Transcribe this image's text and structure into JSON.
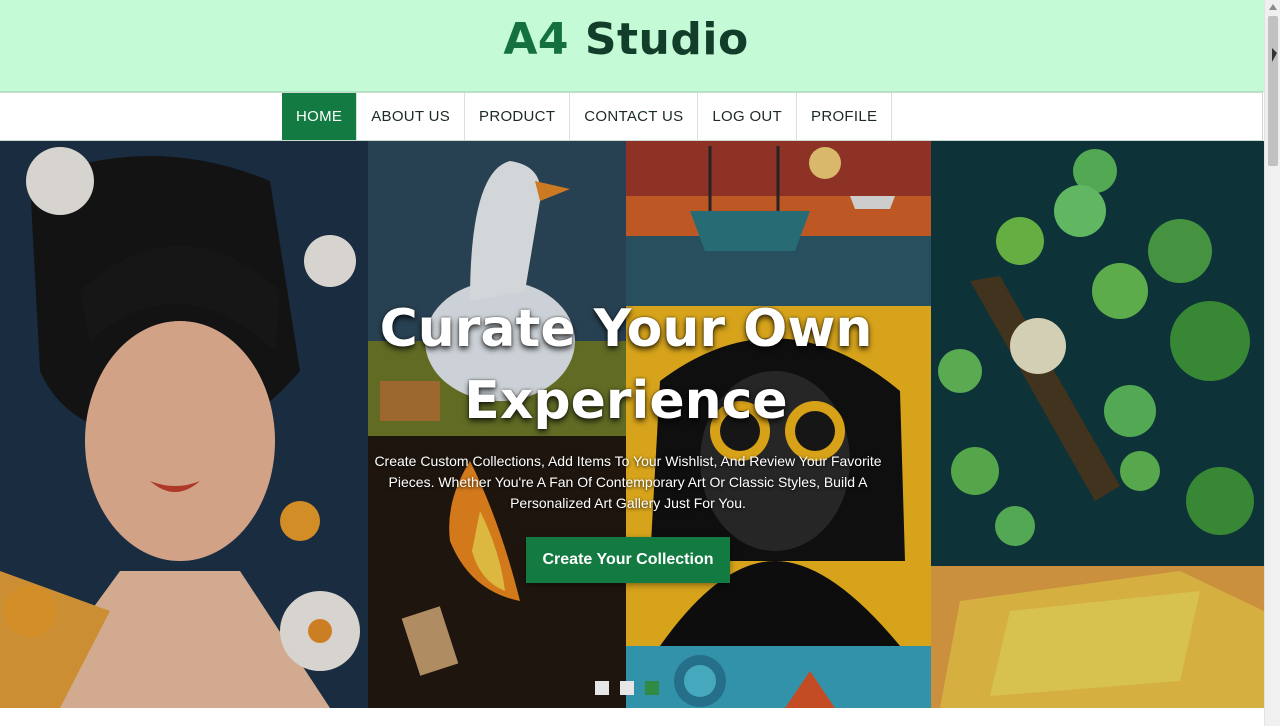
{
  "header": {
    "brand_accent": "A4",
    "brand_rest": " Studio"
  },
  "nav": {
    "items": [
      {
        "label": "HOME",
        "active": true
      },
      {
        "label": "ABOUT US",
        "active": false
      },
      {
        "label": "PRODUCT",
        "active": false
      },
      {
        "label": "CONTACT US",
        "active": false
      },
      {
        "label": "LOG OUT",
        "active": false
      },
      {
        "label": "PROFILE",
        "active": false
      }
    ]
  },
  "hero": {
    "title_line1": "Curate Your Own",
    "title_line2": "Experience",
    "subtitle": "Create Custom Collections, Add Items To Your Wishlist, And Review Your Favorite Pieces. Whether You're A Fan Of Contemporary Art Or Classic Styles, Build A Personalized Art Gallery Just For You.",
    "cta_label": "Create Your Collection",
    "slides": 3,
    "active_slide": 3
  },
  "colors": {
    "header_bg": "#c4fad6",
    "brand_accent": "#15703f",
    "brand_text": "#123d2a",
    "primary_green": "#137a42"
  }
}
